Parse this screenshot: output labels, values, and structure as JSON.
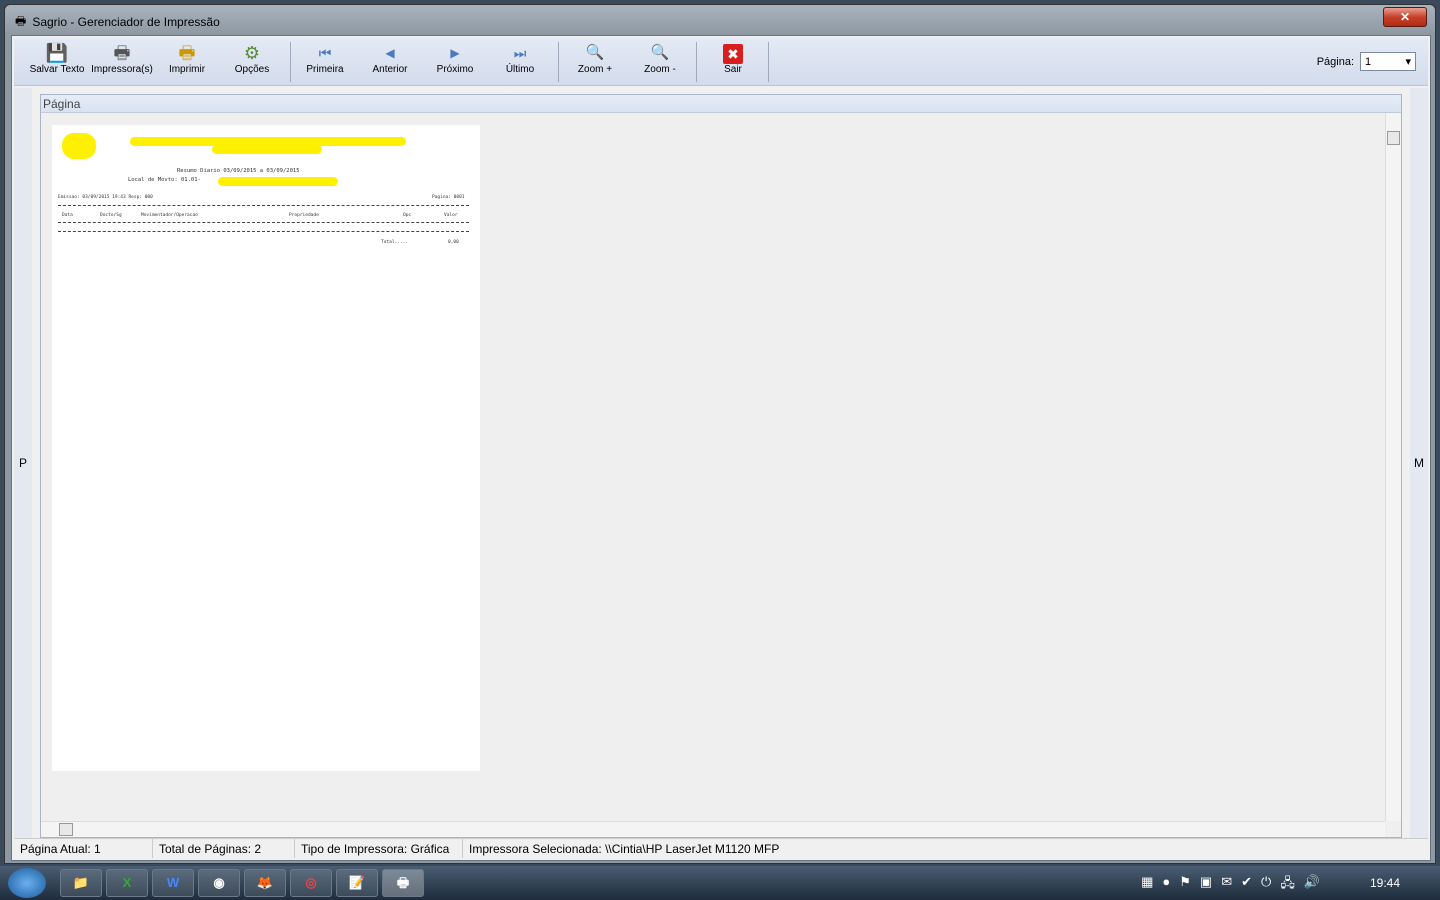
{
  "window": {
    "title": "Sagrio - Gerenciador de Impressão",
    "close": "✕"
  },
  "toolbar": {
    "buttons": [
      {
        "label": "Salvar Texto",
        "icon": "floppy-icon",
        "glyph": "💾"
      },
      {
        "label": "Impressora(s)",
        "icon": "printer-icon",
        "glyph": "🖶"
      },
      {
        "label": "Imprimir",
        "icon": "print-icon",
        "glyph": "🖶"
      },
      {
        "label": "Opções",
        "icon": "printer-options-icon",
        "glyph": "⚙"
      },
      {
        "label": "Primeira",
        "icon": "first-page-icon",
        "glyph": "⏮"
      },
      {
        "label": "Anterior",
        "icon": "previous-icon",
        "glyph": "◀"
      },
      {
        "label": "Próximo",
        "icon": "next-icon",
        "glyph": "▶"
      },
      {
        "label": "Último",
        "icon": "last-page-icon",
        "glyph": "⏭"
      },
      {
        "label": "Zoom +",
        "icon": "zoom-in-icon",
        "glyph": "🔍"
      },
      {
        "label": "Zoom -",
        "icon": "zoom-out-icon",
        "glyph": "🔍"
      },
      {
        "label": "Sair",
        "icon": "exit-icon",
        "glyph": "✖"
      }
    ],
    "page_label": "Página:",
    "page_value": "1"
  },
  "side": {
    "left": "P",
    "right": "M"
  },
  "panel": {
    "title": "Página"
  },
  "report": {
    "subtitle": "Resumo Diario 03/09/2015 a 03/09/2015",
    "local": "Local de Movto: 01.01-",
    "emissao": "Emissao: 03/09/2015 19:43 Resp: 000",
    "pagina": "Pagina: 0001",
    "columns": [
      "Data",
      "Docto/Sg",
      "Movimentador/Operacao",
      "Propriedade",
      "Opc",
      "Valor"
    ],
    "total_label": "Total.....",
    "total_value": "0,00"
  },
  "status": {
    "current": "Página Atual: 1",
    "total": "Total de Páginas: 2",
    "type": "Tipo de Impressora: Gráfica",
    "printer": "Impressora Selecionada: \\\\Cintia\\HP LaserJet M1120 MFP"
  },
  "taskbar": {
    "clock": "19:44",
    "apps": [
      "📁",
      "X",
      "W",
      "◉",
      "🦊",
      "◎",
      "📝",
      "🖶"
    ]
  }
}
